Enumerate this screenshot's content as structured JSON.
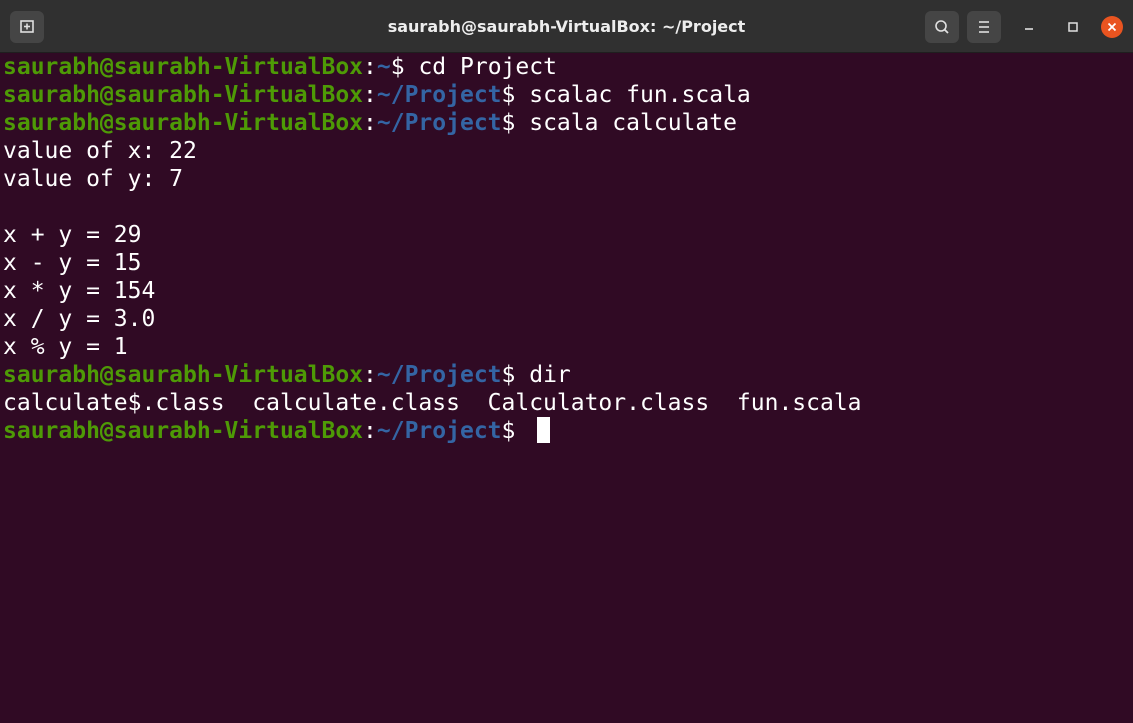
{
  "window": {
    "title": "saurabh@saurabh-VirtualBox: ~/Project"
  },
  "theme": {
    "background": "#300a24",
    "prompt_user_color": "#4e9a06",
    "prompt_path_color": "#3465a4",
    "text_color": "#ffffff",
    "close_button_color": "#e95420"
  },
  "titlebar": {
    "icons": [
      "new-tab-icon",
      "search-icon",
      "hamburger-menu-icon",
      "minimize-icon",
      "maximize-icon",
      "close-icon"
    ]
  },
  "terminal": {
    "prompt_user": "saurabh@saurabh-VirtualBox",
    "prompt_sep": ":",
    "lines": [
      {
        "type": "prompt",
        "path": "~",
        "command": " cd Project"
      },
      {
        "type": "prompt",
        "path": "~/Project",
        "command": " scalac fun.scala"
      },
      {
        "type": "prompt",
        "path": "~/Project",
        "command": " scala calculate"
      },
      {
        "type": "output",
        "text": "value of x: 22"
      },
      {
        "type": "output",
        "text": "value of y: 7"
      },
      {
        "type": "output",
        "text": ""
      },
      {
        "type": "output",
        "text": "x + y = 29"
      },
      {
        "type": "output",
        "text": "x - y = 15"
      },
      {
        "type": "output",
        "text": "x * y = 154"
      },
      {
        "type": "output",
        "text": "x / y = 3.0"
      },
      {
        "type": "output",
        "text": "x % y = 1"
      },
      {
        "type": "prompt",
        "path": "~/Project",
        "command": " dir"
      },
      {
        "type": "output",
        "text": "calculate$.class  calculate.class  Calculator.class  fun.scala"
      },
      {
        "type": "prompt",
        "path": "~/Project",
        "command": " ",
        "cursor": true
      }
    ]
  }
}
